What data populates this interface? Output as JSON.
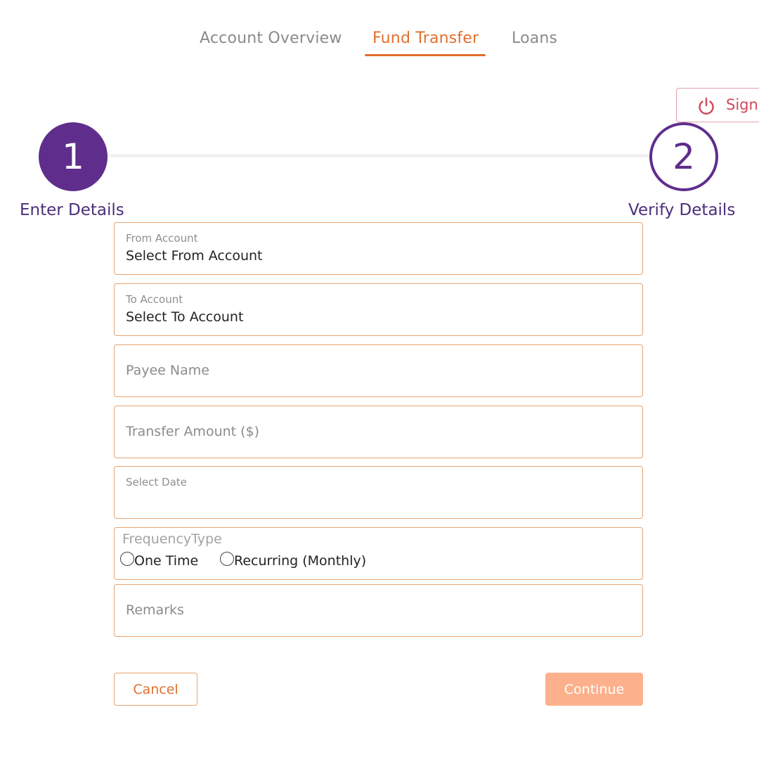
{
  "nav": {
    "tabs": [
      {
        "label": "Account Overview",
        "active": false
      },
      {
        "label": "Fund Transfer",
        "active": true
      },
      {
        "label": "Loans",
        "active": false
      }
    ]
  },
  "header": {
    "signout_label": "Sign",
    "signout_icon": "power-icon"
  },
  "stepper": {
    "steps": [
      {
        "number": "1",
        "label": "Enter Details",
        "state": "current"
      },
      {
        "number": "2",
        "label": "Verify Details",
        "state": "pending"
      }
    ]
  },
  "form": {
    "from_account": {
      "label": "From Account",
      "value": "Select From Account"
    },
    "to_account": {
      "label": "To Account",
      "value": "Select To Account"
    },
    "payee_name": {
      "placeholder": "Payee Name",
      "value": ""
    },
    "transfer_amount": {
      "placeholder": "Transfer Amount ($)",
      "value": ""
    },
    "select_date": {
      "label": "Select Date",
      "value": ""
    },
    "frequency": {
      "legend": "FrequencyType",
      "options": [
        {
          "label": "One Time",
          "selected": false
        },
        {
          "label": "Recurring (Monthly)",
          "selected": false
        }
      ]
    },
    "remarks": {
      "placeholder": "Remarks",
      "value": ""
    }
  },
  "actions": {
    "cancel_label": "Cancel",
    "continue_label": "Continue"
  },
  "colors": {
    "accent": "#e0702e",
    "brand_purple": "#5f2e8c",
    "field_border": "#e8a46f",
    "continue_bg": "#fdb08c",
    "signout": "#d1485a"
  }
}
